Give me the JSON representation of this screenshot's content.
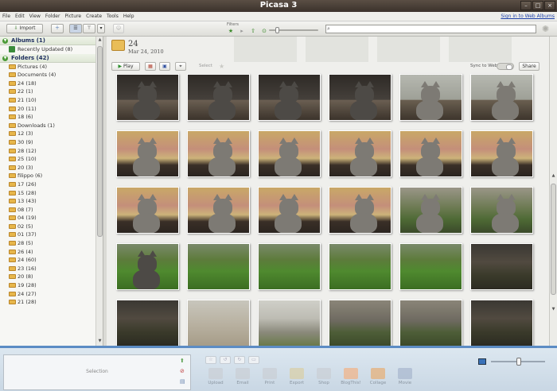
{
  "window": {
    "title": "Picasa 3"
  },
  "menu": [
    "File",
    "Edit",
    "View",
    "Folder",
    "Picture",
    "Create",
    "Tools",
    "Help"
  ],
  "signin": "Sign in to Web Albums",
  "toolbar": {
    "import_label": "Import",
    "filters_label": "Filters",
    "search_placeholder": ""
  },
  "sidebar": {
    "albums_header": "Albums (1)",
    "albums": [
      {
        "label": "Recently Updated (8)"
      }
    ],
    "folders_header": "Folders (42)",
    "folders": [
      {
        "label": "Pictures (4)"
      },
      {
        "label": "Documents (4)"
      },
      {
        "label": "24 (18)"
      },
      {
        "label": "22 (1)"
      },
      {
        "label": "21 (10)"
      },
      {
        "label": "20 (11)"
      },
      {
        "label": "18 (6)"
      },
      {
        "label": "Downloads (1)"
      },
      {
        "label": "12 (3)"
      },
      {
        "label": "30 (9)"
      },
      {
        "label": "28 (12)"
      },
      {
        "label": "25 (10)"
      },
      {
        "label": "20 (3)"
      },
      {
        "label": "filippo (6)"
      },
      {
        "label": "17 (26)"
      },
      {
        "label": "15 (28)"
      },
      {
        "label": "13 (43)"
      },
      {
        "label": "08 (7)"
      },
      {
        "label": "04 (19)"
      },
      {
        "label": "02 (5)"
      },
      {
        "label": "01 (37)"
      },
      {
        "label": "28 (5)"
      },
      {
        "label": "26 (4)"
      },
      {
        "label": "24 (60)"
      },
      {
        "label": "23 (16)"
      },
      {
        "label": "20 (8)"
      },
      {
        "label": "19 (28)"
      },
      {
        "label": "24 (27)"
      },
      {
        "label": "21 (28)"
      }
    ]
  },
  "album": {
    "name": "24",
    "date": "Mar 24, 2010"
  },
  "actionbar": {
    "play_label": "Play",
    "select_label": "Select",
    "sync_label": "Sync to Web",
    "share_label": "Share"
  },
  "tray": {
    "selection_label": "Selection",
    "actions": [
      "Upload",
      "Email",
      "Print",
      "Export",
      "Shop",
      "BlogThis!",
      "Collage",
      "Movie"
    ]
  },
  "colors": {
    "title_bg": "#3b322b",
    "tray_border": "#5c8cc4",
    "folder": "#e7b64a",
    "accent_green": "#4c9a37"
  }
}
